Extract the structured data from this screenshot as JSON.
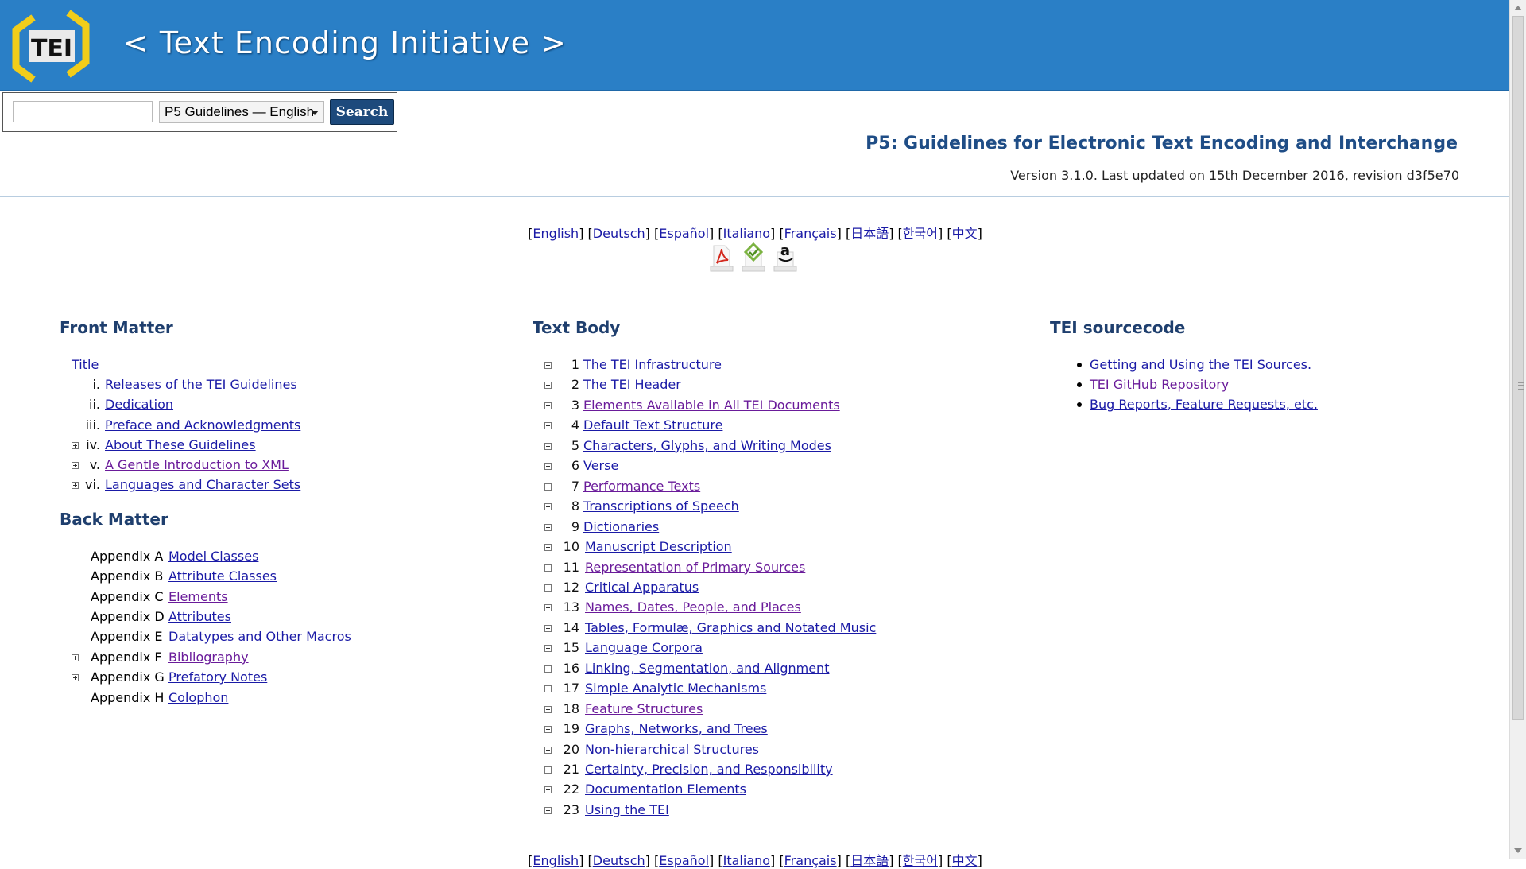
{
  "header": {
    "logo_text": "TEI",
    "site_title": "< Text Encoding Initiative >",
    "colors": {
      "banner": "#2a7fc6",
      "logo_bracket": "#f2cd1a",
      "heading": "#1f4d86"
    }
  },
  "search": {
    "input_value": "",
    "select_value": "P5 Guidelines — English",
    "button_label": "Search"
  },
  "page": {
    "heading": "P5: Guidelines for Electronic Text Encoding and Interchange",
    "version": "Version 3.1.0. Last updated on 15th December 2016, revision d3f5e70"
  },
  "languages": [
    "English",
    "Deutsch",
    "Español",
    "Italiano",
    "Français",
    "日本語",
    "한국어",
    "中文"
  ],
  "format_icons": [
    "pdf-icon",
    "epub-icon",
    "amazon-icon"
  ],
  "front_matter": {
    "heading": "Front Matter",
    "title_link": "Title",
    "items": [
      {
        "num": "i.",
        "label": "Releases of the TEI Guidelines",
        "expandable": false
      },
      {
        "num": "ii.",
        "label": "Dedication",
        "expandable": false
      },
      {
        "num": "iii.",
        "label": "Preface and Acknowledgments",
        "expandable": false
      },
      {
        "num": "iv.",
        "label": "About These Guidelines",
        "expandable": true
      },
      {
        "num": "v.",
        "label": "A Gentle Introduction to XML",
        "expandable": true
      },
      {
        "num": "vi.",
        "label": "Languages and Character Sets",
        "expandable": true
      }
    ]
  },
  "back_matter": {
    "heading": "Back Matter",
    "items": [
      {
        "num": "Appendix A",
        "label": "Model Classes",
        "expandable": false
      },
      {
        "num": "Appendix B",
        "label": "Attribute Classes",
        "expandable": false
      },
      {
        "num": "Appendix C",
        "label": "Elements",
        "expandable": false
      },
      {
        "num": "Appendix D",
        "label": "Attributes",
        "expandable": false
      },
      {
        "num": "Appendix E",
        "label": "Datatypes and Other Macros",
        "expandable": false
      },
      {
        "num": "Appendix F",
        "label": "Bibliography",
        "expandable": true
      },
      {
        "num": "Appendix G",
        "label": "Prefatory Notes",
        "expandable": true
      },
      {
        "num": "Appendix H",
        "label": "Colophon",
        "expandable": false
      }
    ]
  },
  "text_body": {
    "heading": "Text Body",
    "items": [
      {
        "num": "1",
        "label": "The TEI Infrastructure"
      },
      {
        "num": "2",
        "label": "The TEI Header"
      },
      {
        "num": "3",
        "label": "Elements Available in All TEI Documents"
      },
      {
        "num": "4",
        "label": "Default Text Structure"
      },
      {
        "num": "5",
        "label": "Characters, Glyphs, and Writing Modes"
      },
      {
        "num": "6",
        "label": "Verse"
      },
      {
        "num": "7",
        "label": "Performance Texts"
      },
      {
        "num": "8",
        "label": "Transcriptions of Speech"
      },
      {
        "num": "9",
        "label": "Dictionaries"
      },
      {
        "num": "10",
        "label": "Manuscript Description"
      },
      {
        "num": "11",
        "label": "Representation of Primary Sources"
      },
      {
        "num": "12",
        "label": "Critical Apparatus"
      },
      {
        "num": "13",
        "label": "Names, Dates, People, and Places"
      },
      {
        "num": "14",
        "label": "Tables, Formulæ, Graphics and Notated Music"
      },
      {
        "num": "15",
        "label": "Language Corpora"
      },
      {
        "num": "16",
        "label": "Linking, Segmentation, and Alignment"
      },
      {
        "num": "17",
        "label": "Simple Analytic Mechanisms"
      },
      {
        "num": "18",
        "label": "Feature Structures"
      },
      {
        "num": "19",
        "label": "Graphs, Networks, and Trees"
      },
      {
        "num": "20",
        "label": "Non-hierarchical Structures"
      },
      {
        "num": "21",
        "label": "Certainty, Precision, and Responsibility"
      },
      {
        "num": "22",
        "label": "Documentation Elements"
      },
      {
        "num": "23",
        "label": "Using the TEI"
      }
    ]
  },
  "tei_sourcecode": {
    "heading": "TEI sourcecode",
    "items": [
      "Getting and Using the TEI Sources.",
      "TEI GitHub Repository",
      "Bug Reports, Feature Requests, etc."
    ]
  }
}
